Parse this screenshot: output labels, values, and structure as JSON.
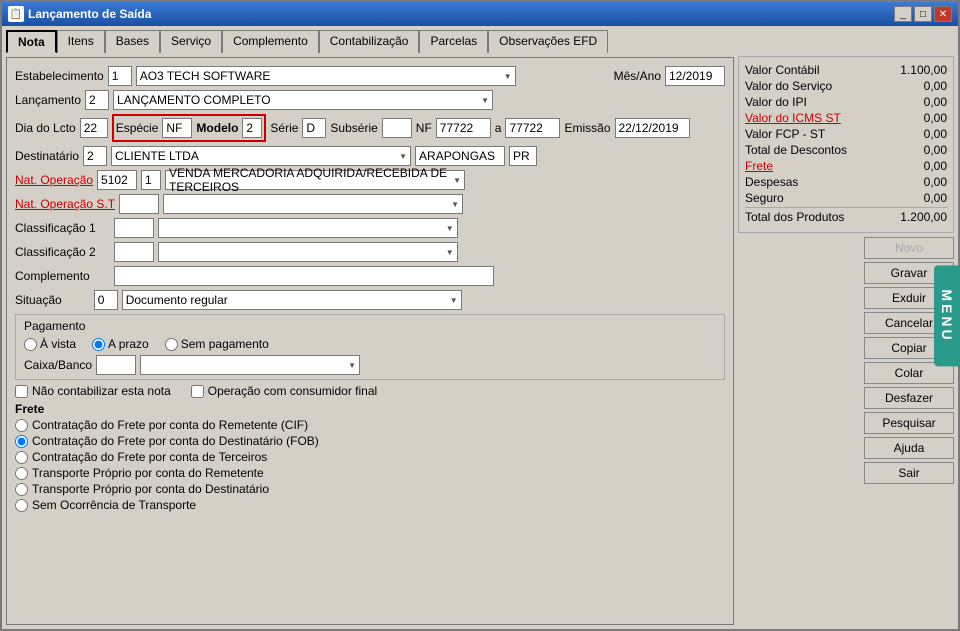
{
  "window": {
    "title": "Lançamento de Saída",
    "icon": "📋"
  },
  "tabs": [
    {
      "label": "Nota",
      "active": true
    },
    {
      "label": "Itens",
      "active": false
    },
    {
      "label": "Bases",
      "active": false
    },
    {
      "label": "Serviço",
      "active": false
    },
    {
      "label": "Complemento",
      "active": false
    },
    {
      "label": "Contabilização",
      "active": false
    },
    {
      "label": "Parcelas",
      "active": false
    },
    {
      "label": "Observações EFD",
      "active": false
    }
  ],
  "form": {
    "estabelecimento_label": "Estabelecimento",
    "estabelecimento_num": "1",
    "estabelecimento_name": "AO3 TECH SOFTWARE",
    "mes_ano_label": "Mês/Ano",
    "mes_ano_value": "12/2019",
    "lancamento_label": "Lançamento",
    "lancamento_num": "2",
    "lancamento_name": "LANÇAMENTO COMPLETO",
    "dia_label": "Dia do Lcto",
    "dia_value": "22",
    "especie_label": "Espécie",
    "especie_value": "NF",
    "modelo_label": "Modelo",
    "modelo_value": "2",
    "serie_label": "Série",
    "serie_value": "D",
    "subserie_label": "Subsérie",
    "subserie_value": "",
    "nf_label": "NF",
    "nf_value": "77722",
    "a_label": "a",
    "nf_value2": "77722",
    "emissao_label": "Emissão",
    "emissao_value": "22/12/2019",
    "destinatario_label": "Destinatário",
    "destinatario_num": "2",
    "destinatario_name": "CLIENTE LTDA",
    "destinatario_city": "ARAPONGAS",
    "destinatario_state": "PR",
    "nat_operacao_label": "Nat. Operação",
    "nat_operacao_code": "5102",
    "nat_operacao_num": "1",
    "nat_operacao_desc": "VENDA MERCADORIA ADQUIRIDA/RECEBIDA DE TERCEIROS",
    "nat_operacao_st_label": "Nat. Operação S.T",
    "classificacao1_label": "Classificação 1",
    "classificacao2_label": "Classificação 2",
    "complemento_label": "Complemento",
    "situacao_label": "Situação",
    "situacao_num": "0",
    "situacao_desc": "Documento regular",
    "pagamento_title": "Pagamento",
    "radio_avista": "À vista",
    "radio_aprazo": "A prazo",
    "radio_sempagamento": "Sem pagamento",
    "caixa_banco_label": "Caixa/Banco",
    "checkbox_nao_contabilizar": "Não contabilizar esta nota",
    "checkbox_consumidor_final": "Operação com consumidor final",
    "frete_title": "Frete",
    "frete_options": [
      "Contratação do Frete por conta do Remetente (CIF)",
      "Contratação do Frete por conta do Destinatário (FOB)",
      "Contratação do Frete por conta de Terceiros",
      "Transporte Próprio por conta do Remetente",
      "Transporte Próprio por conta do Destinatário",
      "Sem Ocorrência de Transporte"
    ],
    "frete_selected": 1
  },
  "summary": {
    "valor_contabil_label": "Valor Contábil",
    "valor_contabil": "1.100,00",
    "valor_servico_label": "Valor do Serviço",
    "valor_servico": "0,00",
    "valor_ipi_label": "Valor do IPI",
    "valor_ipi": "0,00",
    "valor_icms_st_label": "Valor do ICMS ST",
    "valor_icms_st": "0,00",
    "valor_fcp_label": "Valor FCP - ST",
    "valor_fcp": "0,00",
    "total_descontos_label": "Total de Descontos",
    "total_descontos": "0,00",
    "frete_label": "Frete",
    "frete": "0,00",
    "despesas_label": "Despesas",
    "despesas": "0,00",
    "seguro_label": "Seguro",
    "seguro": "0,00",
    "total_produtos_label": "Total dos Produtos",
    "total_produtos": "1.200,00"
  },
  "buttons": {
    "novo": "Novo",
    "gravar": "Gravar",
    "excluir": "Exduir",
    "cancelar": "Cancelar",
    "copiar": "Copiar",
    "colar": "Colar",
    "desfazer": "Desfazer",
    "pesquisar": "Pesquisar",
    "ajuda": "Ajuda",
    "sair": "Sair",
    "menu": "MENU"
  }
}
